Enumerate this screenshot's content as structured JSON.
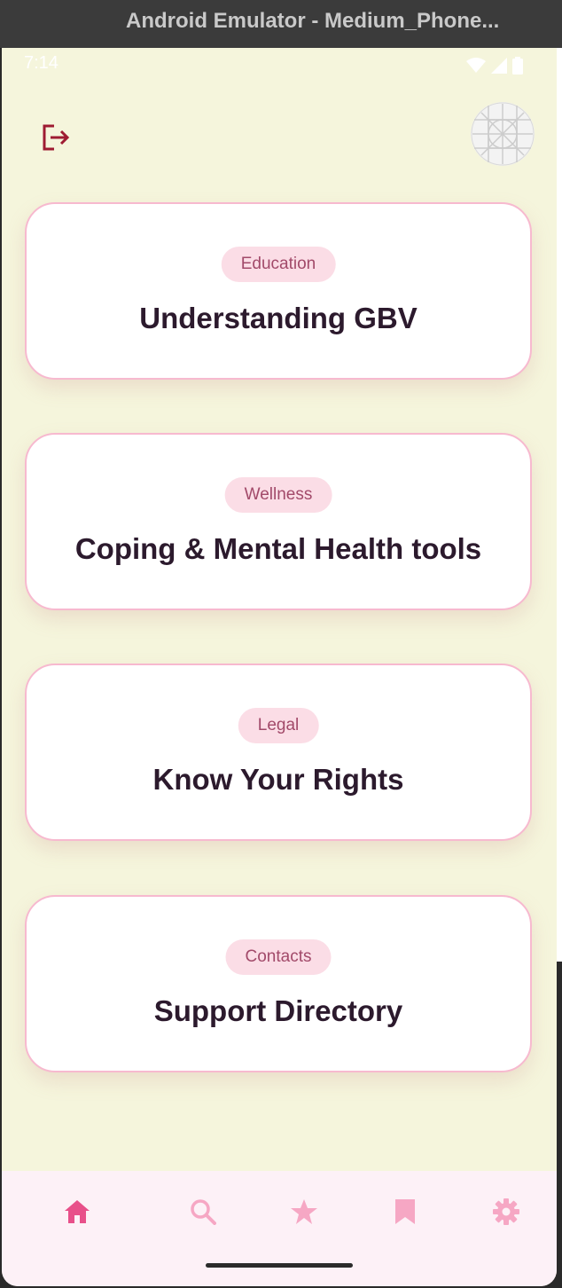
{
  "window": {
    "title": "Android Emulator - Medium_Phone..."
  },
  "status_bar": {
    "time": "7:14",
    "icons": [
      "wifi-icon",
      "signal-icon",
      "battery-icon"
    ]
  },
  "header": {
    "logout_icon": "logout-icon",
    "avatar_icon": "avatar-placeholder"
  },
  "cards": [
    {
      "tag": "Education",
      "title": "Understanding GBV"
    },
    {
      "tag": "Wellness",
      "title": "Coping & Mental Health tools"
    },
    {
      "tag": "Legal",
      "title": "Know Your Rights"
    },
    {
      "tag": "Contacts",
      "title": "Support Directory"
    }
  ],
  "bottom_nav": {
    "items": [
      {
        "icon": "home-icon",
        "active": true
      },
      {
        "icon": "search-icon",
        "active": false
      },
      {
        "icon": "star-icon",
        "active": false
      },
      {
        "icon": "bookmark-icon",
        "active": false
      },
      {
        "icon": "settings-icon",
        "active": false
      }
    ]
  },
  "colors": {
    "background": "#f5f5dc",
    "card_border": "#f7b9cf",
    "chip_bg": "#fbdde6",
    "chip_text": "#a24a6a",
    "title_text": "#2c1a2d",
    "nav_active": "#e8508a",
    "nav_inactive": "#f6a7c4",
    "logout_red": "#9e1b32"
  }
}
